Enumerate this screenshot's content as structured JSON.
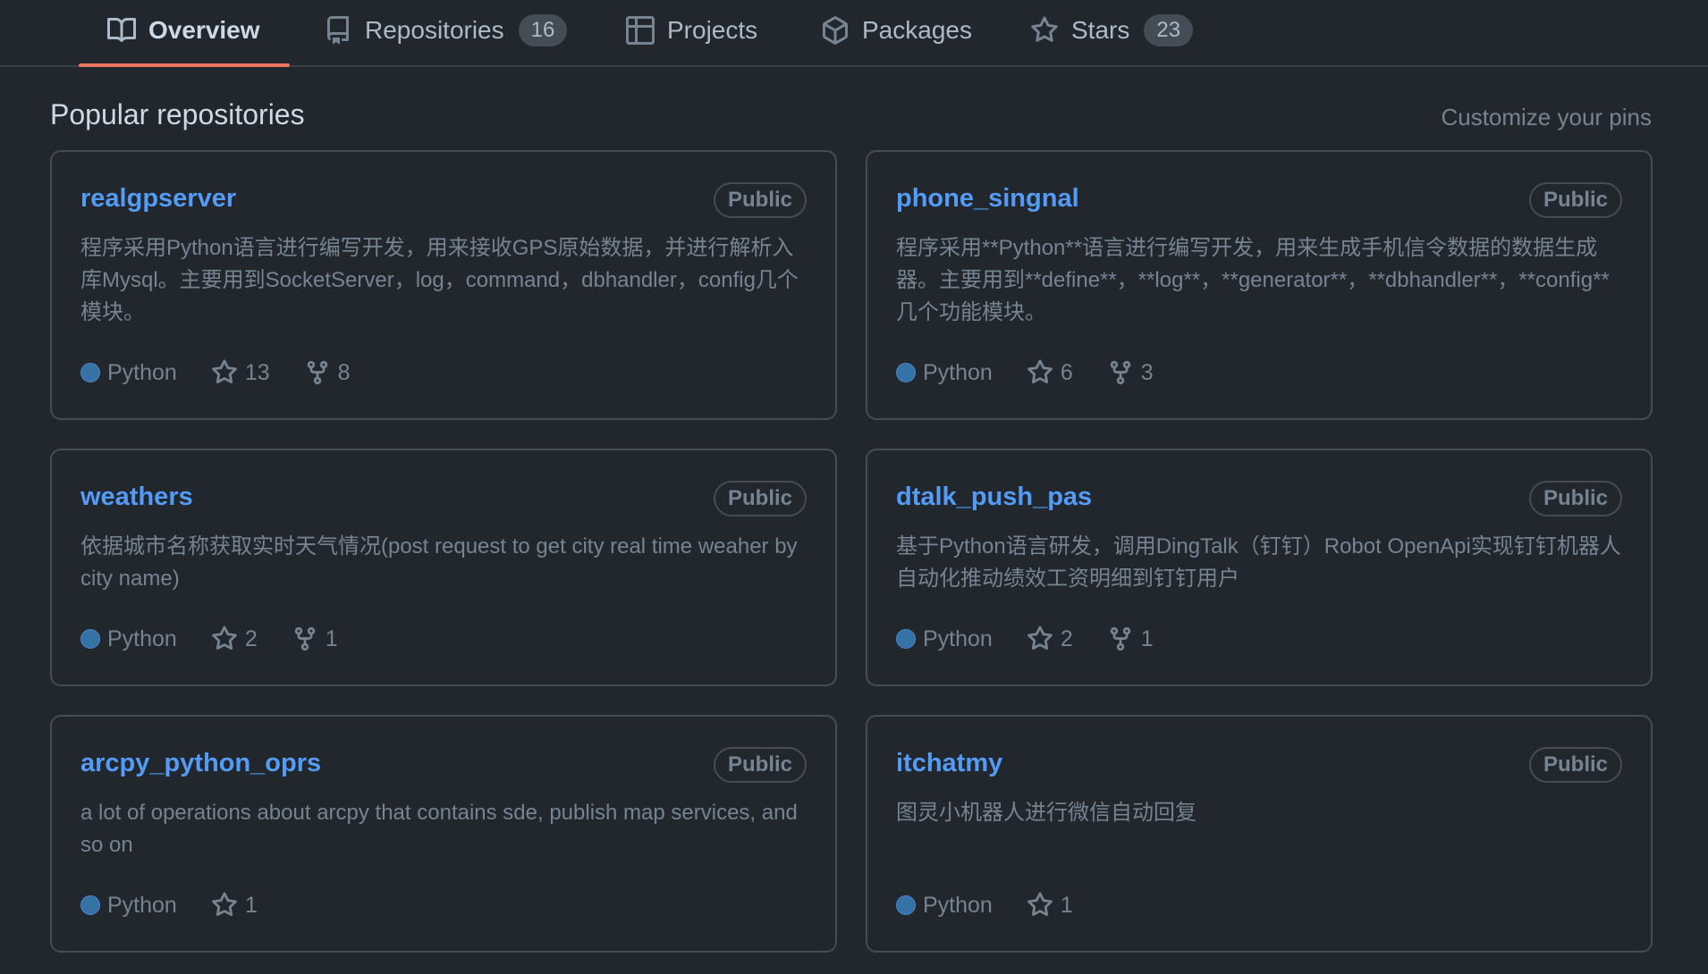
{
  "tabs": [
    {
      "label": "Overview",
      "icon": "book-icon",
      "count": null,
      "active": true
    },
    {
      "label": "Repositories",
      "icon": "repo-icon",
      "count": "16",
      "active": false
    },
    {
      "label": "Projects",
      "icon": "table-icon",
      "count": null,
      "active": false
    },
    {
      "label": "Packages",
      "icon": "package-icon",
      "count": null,
      "active": false
    },
    {
      "label": "Stars",
      "icon": "star-icon",
      "count": "23",
      "active": false
    }
  ],
  "section": {
    "title": "Popular repositories",
    "customize": "Customize your pins"
  },
  "repos": [
    {
      "name": "realgpserver",
      "visibility": "Public",
      "description": "程序采用Python语言进行编写开发，用来接收GPS原始数据，并进行解析入库Mysql。主要用到SocketServer，log，command，dbhandler，config几个模块。",
      "language": "Python",
      "stars": "13",
      "forks": "8"
    },
    {
      "name": "phone_singnal",
      "visibility": "Public",
      "description": "程序采用**Python**语言进行编写开发，用来生成手机信令数据的数据生成器。主要用到**define**，**log**，**generator**，**dbhandler**，**config**几个功能模块。",
      "language": "Python",
      "stars": "6",
      "forks": "3"
    },
    {
      "name": "weathers",
      "visibility": "Public",
      "description": "依据城市名称获取实时天气情况(post request to get city real time weaher by city name)",
      "language": "Python",
      "stars": "2",
      "forks": "1"
    },
    {
      "name": "dtalk_push_pas",
      "visibility": "Public",
      "description": "基于Python语言研发，调用DingTalk（钉钉）Robot OpenApi实现钉钉机器人自动化推动绩效工资明细到钉钉用户",
      "language": "Python",
      "stars": "2",
      "forks": "1"
    },
    {
      "name": "arcpy_python_oprs",
      "visibility": "Public",
      "description": "a lot of operations about arcpy that contains sde, publish map services, and so on",
      "language": "Python",
      "stars": "1",
      "forks": null
    },
    {
      "name": "itchatmy",
      "visibility": "Public",
      "description": "图灵小机器人进行微信自动回复",
      "language": "Python",
      "stars": "1",
      "forks": null
    }
  ],
  "colors": {
    "background": "#22272e",
    "link": "#539bf5",
    "active_tab_underline": "#ec775c",
    "python": "#3572a5"
  }
}
